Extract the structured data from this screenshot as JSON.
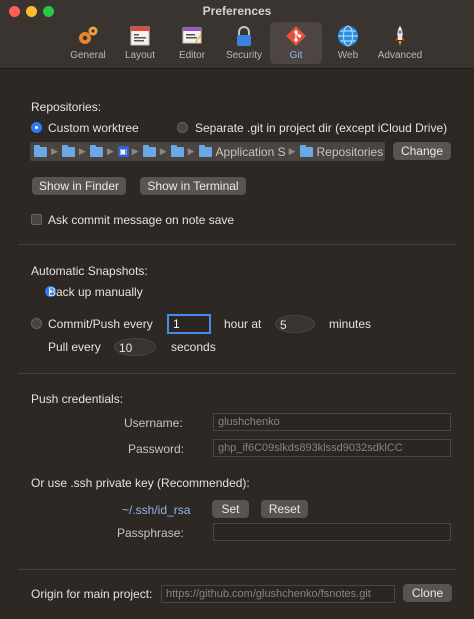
{
  "window": {
    "title": "Preferences"
  },
  "toolbar": {
    "tabs": [
      {
        "label": "General",
        "icon": "gear-icon"
      },
      {
        "label": "Layout",
        "icon": "layout-icon"
      },
      {
        "label": "Editor",
        "icon": "editor-icon"
      },
      {
        "label": "Security",
        "icon": "lock-icon"
      },
      {
        "label": "Git",
        "icon": "git-icon",
        "active": true
      },
      {
        "label": "Web",
        "icon": "globe-icon"
      },
      {
        "label": "Advanced",
        "icon": "rocket-icon"
      }
    ]
  },
  "repositories": {
    "heading": "Repositories:",
    "option_custom": "Custom worktree",
    "option_separate": "Separate .git in project dir (except iCloud Drive)",
    "path_crumbs": [
      "Application S",
      "Repositories"
    ],
    "change_button": "Change",
    "show_finder": "Show in Finder",
    "show_terminal": "Show in Terminal",
    "ask_commit": "Ask commit message on note save"
  },
  "snapshots": {
    "heading": "Automatic Snapshots:",
    "backup_manual": "Back up manually",
    "commit_push_every": "Commit/Push every",
    "hours_value": "1",
    "hour_at": "hour at",
    "minutes_value": "5",
    "minutes": "minutes",
    "pull_every": "Pull every",
    "pull_value": "10",
    "seconds": "seconds"
  },
  "credentials": {
    "heading": "Push credentials:",
    "username_label": "Username:",
    "username_value": "glushchenko",
    "password_label": "Password:",
    "password_value": "ghp_if6C09slkds893klssd9032sdklCC",
    "ssh_heading": "Or use .ssh private key (Recommended):",
    "key_path": "~/.ssh/id_rsa",
    "set_button": "Set",
    "reset_button": "Reset",
    "passphrase_label": "Passphrase:",
    "passphrase_value": ""
  },
  "origin": {
    "label": "Origin for main project:",
    "placeholder": "https://github.com/glushchenko/fsnotes.git",
    "clone_button": "Clone"
  }
}
